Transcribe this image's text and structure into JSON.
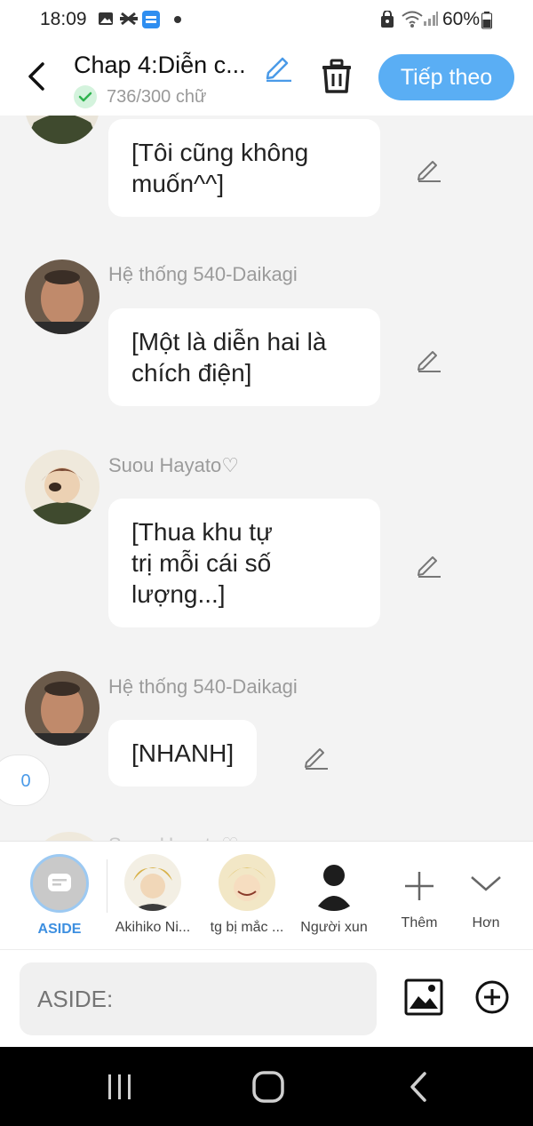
{
  "status": {
    "time": "18:09",
    "battery": "60%"
  },
  "header": {
    "title": "Chap 4:Diễn c...",
    "word_count": "736/300 chữ",
    "next_label": "Tiếp theo"
  },
  "messages": [
    {
      "sender": "",
      "text": "[Tôi cũng không\nmuốn^^]"
    },
    {
      "sender": "Hệ thống 540-Daikagi",
      "text": "[Một là diễn hai là\nchích điện]"
    },
    {
      "sender": "Suou Hayato♡",
      "text": "[Thua khu tự\ntrị mỗi cái số\nlượng...]"
    },
    {
      "sender": "Hệ thống 540-Daikagi",
      "text": "[NHANH]"
    },
    {
      "sender": "Suou Hayato♡",
      "text": ""
    }
  ],
  "counter": "0",
  "characters": [
    {
      "label": "ASIDE"
    },
    {
      "label": "Akihiko Ni..."
    },
    {
      "label": "tg bị mắc ..."
    },
    {
      "label": "Người xun"
    },
    {
      "label": "Thêm"
    },
    {
      "label": "Hơn"
    }
  ],
  "input": {
    "placeholder": "ASIDE:"
  },
  "colors": {
    "accent": "#5aaef4",
    "aside_blue": "#3d8fe0",
    "check_green": "#2fb34f"
  }
}
